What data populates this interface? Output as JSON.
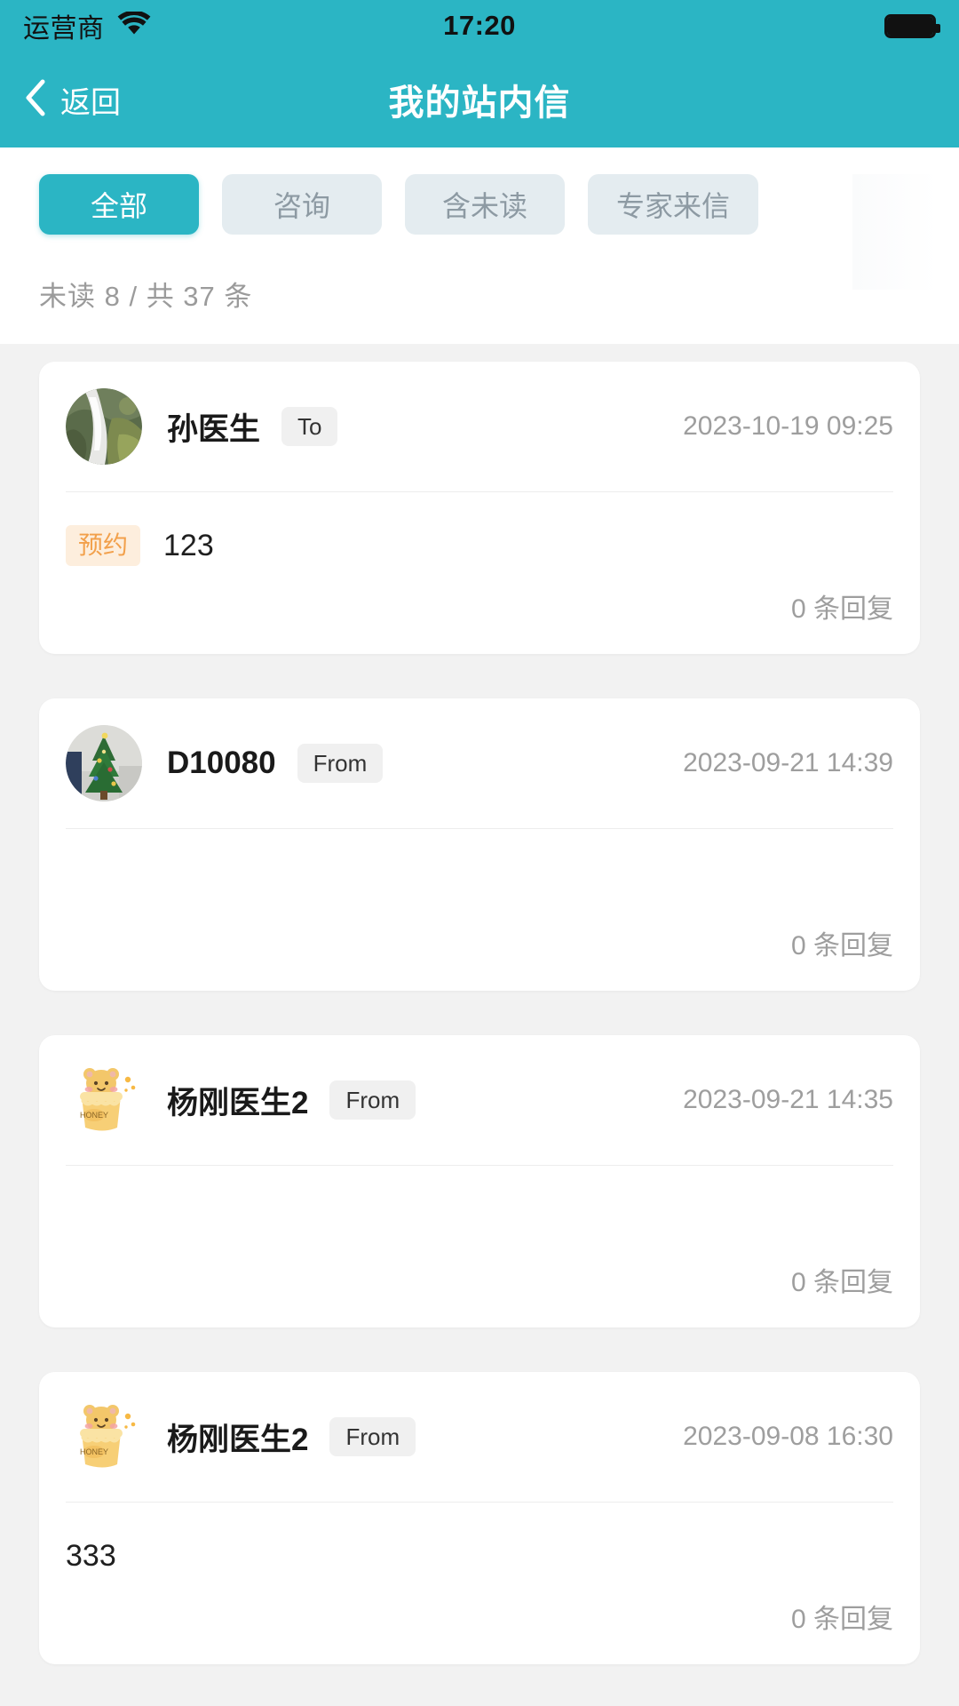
{
  "status_bar": {
    "carrier": "运营商",
    "wifi_icon": "wifi-icon",
    "time": "17:20",
    "battery_icon": "battery-icon"
  },
  "nav": {
    "back_icon": "chevron-left-icon",
    "back_label": "返回",
    "title": "我的站内信"
  },
  "filters": {
    "items": [
      {
        "label": "全部",
        "active": true
      },
      {
        "label": "咨询",
        "active": false
      },
      {
        "label": "含未读",
        "active": false
      },
      {
        "label": "专家来信",
        "active": false
      }
    ]
  },
  "summary": {
    "count_text": "未读 8 / 共 37 条",
    "unread": 8,
    "total": 37
  },
  "messages": [
    {
      "avatar": "waterfall-photo-avatar",
      "sender": "孙医生",
      "direction": "To",
      "date": "2023-10-19 09:25",
      "tag": "预约",
      "body": "123",
      "reply_count": "0 条回复"
    },
    {
      "avatar": "christmas-tree-photo-avatar",
      "sender": "D10080",
      "direction": "From",
      "date": "2023-09-21 14:39",
      "tag": "",
      "body": "",
      "reply_count": "0 条回复"
    },
    {
      "avatar": "honey-bear-avatar",
      "sender": "杨刚医生2",
      "direction": "From",
      "date": "2023-09-21 14:35",
      "tag": "",
      "body": "",
      "reply_count": "0 条回复"
    },
    {
      "avatar": "honey-bear-avatar",
      "sender": "杨刚医生2",
      "direction": "From",
      "date": "2023-09-08 16:30",
      "tag": "",
      "body": "333",
      "reply_count": "0 条回复"
    }
  ],
  "colors": {
    "brand": "#2bb5c4",
    "chip_inactive_bg": "#e4ecf0",
    "chip_inactive_text": "#8d9aa3",
    "tag_bg": "#fdeedd",
    "tag_text": "#f2a04b",
    "page_bg": "#f2f2f2",
    "card_bg": "#ffffff",
    "muted_text": "#9e9e9e"
  }
}
